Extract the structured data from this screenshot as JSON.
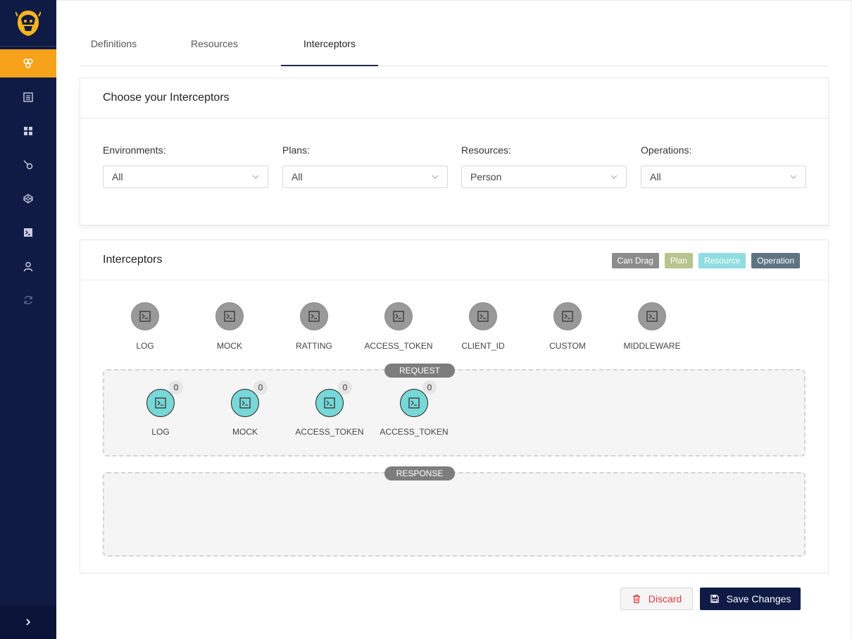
{
  "sidebar": {
    "items": [
      {
        "icon": "interceptors-icon",
        "active": true
      },
      {
        "icon": "list-icon",
        "active": false
      },
      {
        "icon": "dashboard-icon",
        "active": false
      },
      {
        "icon": "connection-icon",
        "active": false
      },
      {
        "icon": "codepen-icon",
        "active": false
      },
      {
        "icon": "terminal-icon",
        "active": false
      },
      {
        "icon": "user-icon",
        "active": false
      },
      {
        "icon": "sync-icon",
        "active": false
      }
    ],
    "colors": {
      "bg": "#0f1b44",
      "active": "#f7a21b"
    }
  },
  "tabs": [
    {
      "label": "Definitions"
    },
    {
      "label": "Resources"
    },
    {
      "label": "Interceptors"
    }
  ],
  "filters": {
    "title": "Choose your Interceptors",
    "fields": [
      {
        "label": "Environments:",
        "value": "All"
      },
      {
        "label": "Plans:",
        "value": "All"
      },
      {
        "label": "Resources:",
        "value": "Person"
      },
      {
        "label": "Operations:",
        "value": "All"
      }
    ]
  },
  "interceptors": {
    "title": "Interceptors",
    "legend": [
      {
        "label": "Can Drag",
        "color": "#8c8c8c"
      },
      {
        "label": "Plan",
        "color": "#b9c38f"
      },
      {
        "label": "Resource",
        "color": "#8fdde0"
      },
      {
        "label": "Operation",
        "color": "#5e7480"
      }
    ],
    "palette": [
      "LOG",
      "MOCK",
      "RATTING",
      "ACCESS_TOKEN",
      "CLIENT_ID",
      "CUSTOM",
      "MIDDLEWARE"
    ],
    "request": {
      "title": "REQUEST",
      "items": [
        {
          "label": "LOG",
          "count": "0"
        },
        {
          "label": "MOCK",
          "count": "0"
        },
        {
          "label": "ACCESS_TOKEN",
          "count": "0"
        },
        {
          "label": "ACCESS_TOKEN",
          "count": "0"
        }
      ]
    },
    "response": {
      "title": "RESPONSE",
      "items": []
    }
  },
  "actions": {
    "discard": "Discard",
    "save": "Save Changes"
  }
}
